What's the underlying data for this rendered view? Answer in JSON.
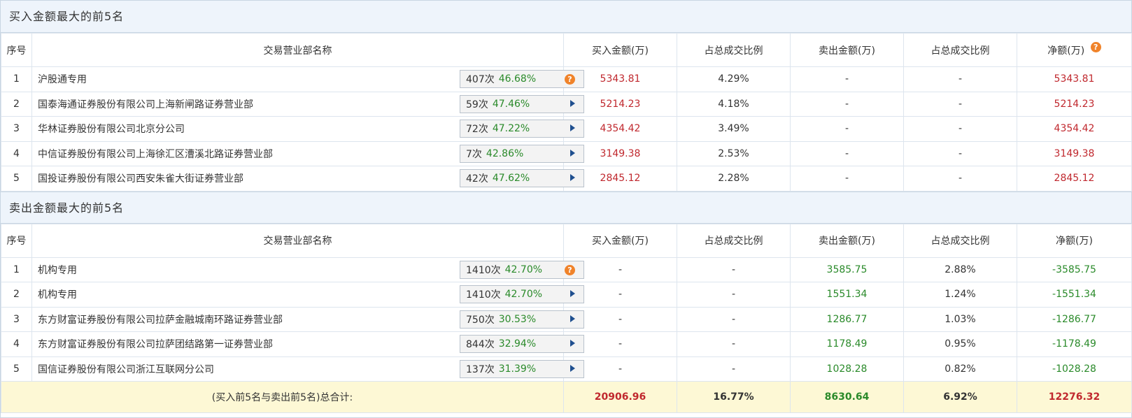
{
  "buy_section": {
    "title": "买入金额最大的前5名",
    "headers": [
      "序号",
      "交易营业部名称",
      "买入金额(万)",
      "占总成交比例",
      "卖出金额(万)",
      "占总成交比例",
      "净额(万)"
    ],
    "rows": [
      {
        "no": "1",
        "name": "沪股通专用",
        "count": "407次",
        "pct": "46.68%",
        "icon": "question-icon",
        "buy": "5343.81",
        "buy_pct": "4.29%",
        "sell": "-",
        "sell_pct": "-",
        "net": "5343.81"
      },
      {
        "no": "2",
        "name": "国泰海通证券股份有限公司上海新闸路证券营业部",
        "count": "59次",
        "pct": "47.46%",
        "icon": "play-icon",
        "buy": "5214.23",
        "buy_pct": "4.18%",
        "sell": "-",
        "sell_pct": "-",
        "net": "5214.23"
      },
      {
        "no": "3",
        "name": "华林证券股份有限公司北京分公司",
        "count": "72次",
        "pct": "47.22%",
        "icon": "play-icon",
        "buy": "4354.42",
        "buy_pct": "3.49%",
        "sell": "-",
        "sell_pct": "-",
        "net": "4354.42"
      },
      {
        "no": "4",
        "name": "中信证券股份有限公司上海徐汇区漕溪北路证券营业部",
        "count": "7次",
        "pct": "42.86%",
        "icon": "play-icon",
        "buy": "3149.38",
        "buy_pct": "2.53%",
        "sell": "-",
        "sell_pct": "-",
        "net": "3149.38"
      },
      {
        "no": "5",
        "name": "国投证券股份有限公司西安朱雀大街证券营业部",
        "count": "42次",
        "pct": "47.62%",
        "icon": "play-icon",
        "buy": "2845.12",
        "buy_pct": "2.28%",
        "sell": "-",
        "sell_pct": "-",
        "net": "2845.12"
      }
    ]
  },
  "sell_section": {
    "title": "卖出金额最大的前5名",
    "headers": [
      "序号",
      "交易营业部名称",
      "买入金额(万)",
      "占总成交比例",
      "卖出金额(万)",
      "占总成交比例",
      "净额(万)"
    ],
    "rows": [
      {
        "no": "1",
        "name": "机构专用",
        "count": "1410次",
        "pct": "42.70%",
        "icon": "question-icon",
        "buy": "-",
        "buy_pct": "-",
        "sell": "3585.75",
        "sell_pct": "2.88%",
        "net": "-3585.75"
      },
      {
        "no": "2",
        "name": "机构专用",
        "count": "1410次",
        "pct": "42.70%",
        "icon": "play-icon",
        "buy": "-",
        "buy_pct": "-",
        "sell": "1551.34",
        "sell_pct": "1.24%",
        "net": "-1551.34"
      },
      {
        "no": "3",
        "name": "东方财富证券股份有限公司拉萨金融城南环路证券营业部",
        "count": "750次",
        "pct": "30.53%",
        "icon": "play-icon",
        "buy": "-",
        "buy_pct": "-",
        "sell": "1286.77",
        "sell_pct": "1.03%",
        "net": "-1286.77"
      },
      {
        "no": "4",
        "name": "东方财富证券股份有限公司拉萨团结路第一证券营业部",
        "count": "844次",
        "pct": "32.94%",
        "icon": "play-icon",
        "buy": "-",
        "buy_pct": "-",
        "sell": "1178.49",
        "sell_pct": "0.95%",
        "net": "-1178.49"
      },
      {
        "no": "5",
        "name": "国信证券股份有限公司浙江互联网分公司",
        "count": "137次",
        "pct": "31.39%",
        "icon": "play-icon",
        "buy": "-",
        "buy_pct": "-",
        "sell": "1028.28",
        "sell_pct": "0.82%",
        "net": "-1028.28"
      }
    ]
  },
  "totals": {
    "label": "(买入前5名与卖出前5名)总合计:",
    "buy": "20906.96",
    "buy_pct": "16.77%",
    "sell": "8630.64",
    "sell_pct": "6.92%",
    "net": "12276.32"
  },
  "colors": {
    "positive": "#c0282e",
    "negative": "#2a8a2a",
    "header_bg": "#eef4fb",
    "total_bg": "#fdf8d5",
    "question_icon": "#f0832a"
  }
}
